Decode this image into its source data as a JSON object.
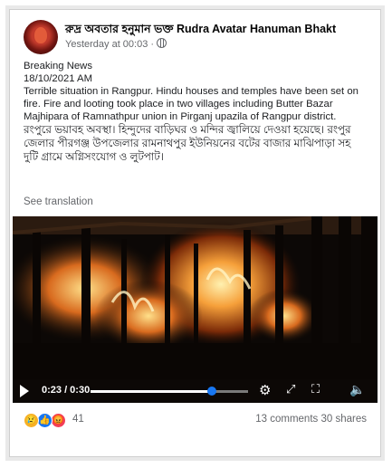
{
  "post": {
    "author": "রুদ্র অবতার হনুমান ভক্ত Rudra Avatar Hanuman Bhakt",
    "timestamp": "Yesterday at 00:03 ·",
    "breaking": "Breaking News",
    "date": "18/10/2021 AM",
    "body_en": "Terrible situation in Rangpur. Hindu houses and temples have been set on fire. Fire and looting took place in two villages including Butter Bazar Majhipara of Ramnathpur union in Pirganj upazila of Rangpur district.",
    "body_bn": "রংপুরে ভয়াবহ অবস্থা। হিন্দুদের বাড়িঘর ও মন্দির জ্বালিয়ে দেওয়া হয়েছে। রংপুর জেলার পীরগঞ্জ উপজেলার রামনাথপুর ইউনিয়নের বটের বাজার মাঝিপাড়া সহ দুটি গ্রামে অগ্নিসংযোগ ও লুটপাট।",
    "see_translation": "See translation",
    "menu_icon": "more-dots-icon",
    "privacy_icon": "globe-icon"
  },
  "video": {
    "time": "0:23 / 0:30",
    "progress": 0.77,
    "icons": [
      "play-icon",
      "settings-icon",
      "expand-icon",
      "fullscreen-icon",
      "volume-icon"
    ]
  },
  "footer": {
    "reaction_count": "41",
    "comments": "13 comments",
    "shares": "30 shares",
    "reaction_icons": [
      "sad-icon",
      "like-icon",
      "angry-icon"
    ]
  },
  "colors": {
    "accent": "#1877f2",
    "fire": "#f6a03a",
    "text_muted": "#65676b"
  }
}
